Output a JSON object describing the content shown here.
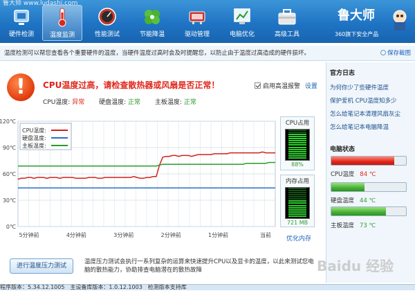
{
  "app": {
    "title": "鲁大师 www.ludashi.com",
    "logo": "鲁大师",
    "logo_sub": "360旗下安全产品",
    "window_buttons": "─ ✕"
  },
  "toolbar": [
    {
      "label": "硬件检测",
      "icon": "hardware-icon"
    },
    {
      "label": "温度监测",
      "icon": "thermometer-icon",
      "active": true
    },
    {
      "label": "性能测试",
      "icon": "speedometer-icon"
    },
    {
      "label": "节能降温",
      "icon": "leaf-icon"
    },
    {
      "label": "驱动管理",
      "icon": "driver-icon"
    },
    {
      "label": "电脑优化",
      "icon": "optimize-icon"
    },
    {
      "label": "高级工具",
      "icon": "toolbox-icon"
    }
  ],
  "infobar": {
    "text": "温度检测可以帮您查看各个重要硬件的温度，当硬件温度过高时会及时提醒您，以防止由于温度过高造成的硬件损坏。",
    "save_label": "保存截图"
  },
  "alert": {
    "title": "CPU温度过高，请检查散热器或风扇是否正常！",
    "cpu_label": "CPU温度:",
    "cpu_status": "异常",
    "disk_label": "硬盘温度:",
    "disk_status": "正常",
    "board_label": "主板温度:",
    "board_status": "正常",
    "alarm_label": "启用高温报警",
    "settings_label": "设置"
  },
  "chart_data": {
    "type": "line",
    "y_ticks": [
      "120℃",
      "90℃",
      "60℃",
      "30℃",
      "0℃"
    ],
    "x_ticks": [
      "5分钟前",
      "4分钟前",
      "3分钟前",
      "2分钟前",
      "1分钟前",
      "当前"
    ],
    "ylim": [
      0,
      120
    ],
    "legend": [
      {
        "name": "CPU温度:",
        "color": "#d0201a"
      },
      {
        "name": "硬盘温度:",
        "color": "#2a6fc7"
      },
      {
        "name": "主板温度:",
        "color": "#2a9a2a"
      }
    ],
    "series": [
      {
        "name": "CPU温度",
        "color": "#d0201a",
        "values": [
          54,
          55,
          55,
          56,
          56,
          55,
          56,
          56,
          56,
          55,
          56,
          56,
          56,
          55,
          56,
          56,
          56,
          56,
          55,
          55,
          55,
          55,
          56,
          56,
          56,
          55,
          55,
          56,
          56,
          56,
          56,
          56,
          56,
          56,
          56,
          56,
          57,
          56,
          55,
          55,
          56,
          56,
          57,
          57,
          70,
          79,
          80,
          80,
          81,
          81,
          80,
          81,
          81,
          81,
          80,
          81,
          82,
          82,
          82,
          82,
          82,
          83,
          83,
          83,
          83,
          83,
          84,
          84,
          84,
          84,
          84,
          84,
          84,
          84,
          84,
          84,
          85,
          84,
          84,
          84,
          84
        ]
      },
      {
        "name": "硬盘温度",
        "color": "#2a6fc7",
        "values": [
          44,
          44,
          44,
          44,
          44,
          44,
          44,
          44,
          44,
          44,
          44,
          44,
          44,
          44,
          44,
          44,
          44,
          44,
          44,
          44,
          44,
          44,
          44,
          44,
          44,
          44,
          44,
          44,
          44,
          44,
          44,
          44,
          44,
          44,
          44,
          44,
          44,
          44,
          44,
          44,
          44,
          44,
          44,
          44,
          44,
          44,
          44,
          44,
          44,
          44,
          44,
          44,
          44,
          44,
          44,
          44,
          44,
          44,
          44,
          44,
          44,
          44,
          44,
          44,
          44,
          44,
          44,
          44,
          44,
          44,
          44,
          44,
          44,
          44,
          44,
          44,
          44,
          44,
          44,
          44,
          44
        ]
      },
      {
        "name": "主板温度",
        "color": "#2a9a2a",
        "values": [
          69,
          69,
          69,
          69,
          69,
          69,
          69,
          69,
          69,
          69,
          69,
          69,
          69,
          69,
          69,
          69,
          69,
          69,
          69,
          69,
          69,
          69,
          69,
          69,
          69,
          69,
          69,
          69,
          69,
          69,
          69,
          69,
          69,
          69,
          69,
          69,
          69,
          69,
          69,
          69,
          69,
          69,
          69,
          69,
          70,
          71,
          71,
          71,
          71,
          71,
          71,
          71,
          71,
          71,
          71,
          71,
          71,
          71,
          71,
          71,
          71,
          71,
          71,
          71,
          71,
          71,
          71,
          71,
          71,
          71,
          71,
          72,
          72,
          72,
          72,
          72,
          72,
          72,
          73,
          73,
          73
        ]
      }
    ]
  },
  "meters": {
    "cpu": {
      "title": "CPU占用",
      "value": "88%",
      "fraction": 0.88
    },
    "mem": {
      "title": "内存占用",
      "value": "721 MB",
      "fraction": 0.55
    }
  },
  "optimize_label": "优化内存",
  "news": {
    "heading": "官方日志",
    "items": [
      "为何你少了些硬件温度",
      "保护爱机 CPU温度知多少",
      "怎么给笔记本清理风扇灰尘",
      "怎么给笔记本电脑降温"
    ]
  },
  "pc_status": {
    "heading": "电脑状态",
    "items": [
      {
        "label": "CPU温度",
        "value": "84 ℃",
        "fraction": 0.84,
        "color": "#e0261a",
        "level": "red"
      },
      {
        "label": "硬盘温度",
        "value": "44 ℃",
        "fraction": 0.44,
        "color": "#46b035",
        "level": "green"
      },
      {
        "label": "主板温度",
        "value": "73 ℃",
        "fraction": 0.73,
        "color": "#46b035",
        "level": "green"
      }
    ]
  },
  "stress": {
    "button_label": "进行温度压力测试",
    "description": "温度压力测试会执行一系列复杂的运算来快速提升CPU以及显卡的温度，以此来测试您电脑的散热能力，协助排查电脑潜在的散热故障"
  },
  "statusbar": "程序版本：5.34.12.1005　主设备库版本：1.0.12.1003　检测版本支持库",
  "watermark": "Baidu 经验"
}
